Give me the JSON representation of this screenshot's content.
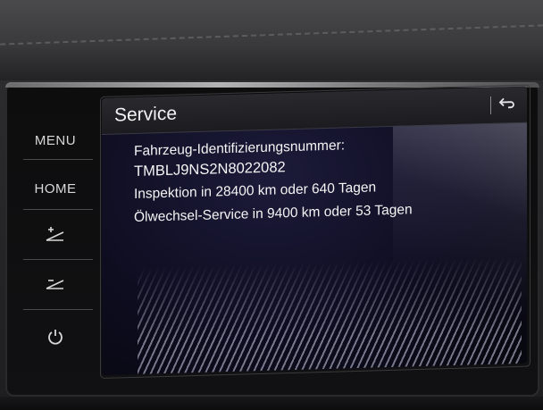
{
  "side_panel": {
    "menu_label": "MENU",
    "home_label": "HOME",
    "icons": [
      "brightness-up-icon",
      "brightness-down-icon",
      "power-icon"
    ]
  },
  "screen": {
    "title": "Service",
    "back_icon": "back-arrow-icon",
    "vin_label": "Fahrzeug-Identifizierungsnummer:",
    "vin_value": "TMBLJ9NS2N8022082",
    "inspection": "Inspektion in 28400 km oder 640 Tagen",
    "oil_service": "Ölwechsel-Service in 9400 km oder 53 Tagen"
  },
  "colors": {
    "screen_bg": "#0e0d20",
    "text": "#f4f4f4",
    "button_text": "#d8d8d8"
  }
}
